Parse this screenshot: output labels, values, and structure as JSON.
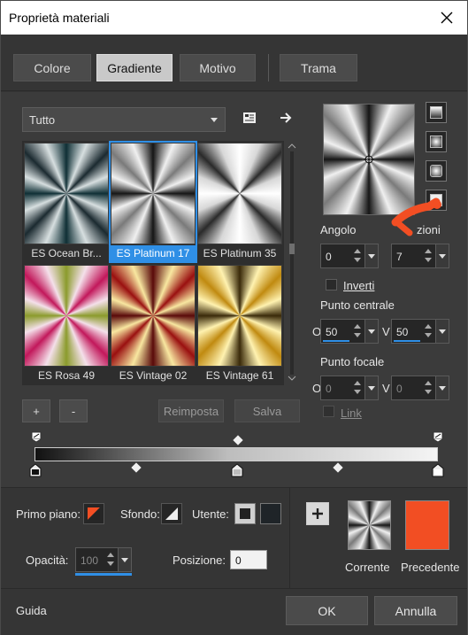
{
  "window": {
    "title": "Proprietà materiali"
  },
  "tabs": [
    {
      "label": "Colore"
    },
    {
      "label": "Gradiente",
      "active": true
    },
    {
      "label": "Motivo"
    },
    {
      "label": "Trama"
    }
  ],
  "category": {
    "selected": "Tutto"
  },
  "gradients": [
    {
      "label": "ES Ocean Br...",
      "colors": [
        "#0f2f35",
        "#d7dfe0",
        "#1b2a30"
      ]
    },
    {
      "label": "ES Platinum 17",
      "colors": [
        "#161616",
        "#f0f0f0",
        "#7a7a7a"
      ],
      "selected": true
    },
    {
      "label": "ES Platinum 35",
      "colors": [
        "#e8e8e8",
        "#ffffff",
        "#2a2a2a"
      ]
    },
    {
      "label": "ES Rosa 49",
      "colors": [
        "#8b9b2c",
        "#f4e0ea",
        "#c2185b"
      ]
    },
    {
      "label": "ES Vintage 02",
      "colors": [
        "#5a0a0a",
        "#f8e7a0",
        "#9a1010"
      ]
    },
    {
      "label": "ES Vintage 61",
      "colors": [
        "#3a2a0a",
        "#fff2b0",
        "#c08a10"
      ]
    }
  ],
  "buttons": {
    "add": "+",
    "remove": "-",
    "reset": "Reimposta",
    "save": "Salva",
    "ok": "OK",
    "cancel": "Annulla",
    "help": "Guida"
  },
  "angle": {
    "label": "Angolo",
    "value": "0"
  },
  "repeats": {
    "label": "Ripetizioni",
    "visible_label": "zioni",
    "value": "7"
  },
  "invert": {
    "label": "Inverti",
    "checked": false
  },
  "center_point": {
    "label": "Punto centrale",
    "h_label": "O",
    "h": "50",
    "v_label": "V",
    "v": "50"
  },
  "focal_point": {
    "label": "Punto focale",
    "h_label": "O",
    "h": "0",
    "v_label": "V",
    "v": "0"
  },
  "link": {
    "label": "Link",
    "checked": false
  },
  "foreground": {
    "label": "Primo piano:"
  },
  "background": {
    "label": "Sfondo:"
  },
  "user": {
    "label": "Utente:"
  },
  "opacity": {
    "label": "Opacità:",
    "value": "100"
  },
  "position": {
    "label": "Posizione:",
    "value": "0"
  },
  "current": {
    "label": "Corrente"
  },
  "previous": {
    "label": "Precedente",
    "color": "#f24e23"
  },
  "accent": "#2f8fe6"
}
